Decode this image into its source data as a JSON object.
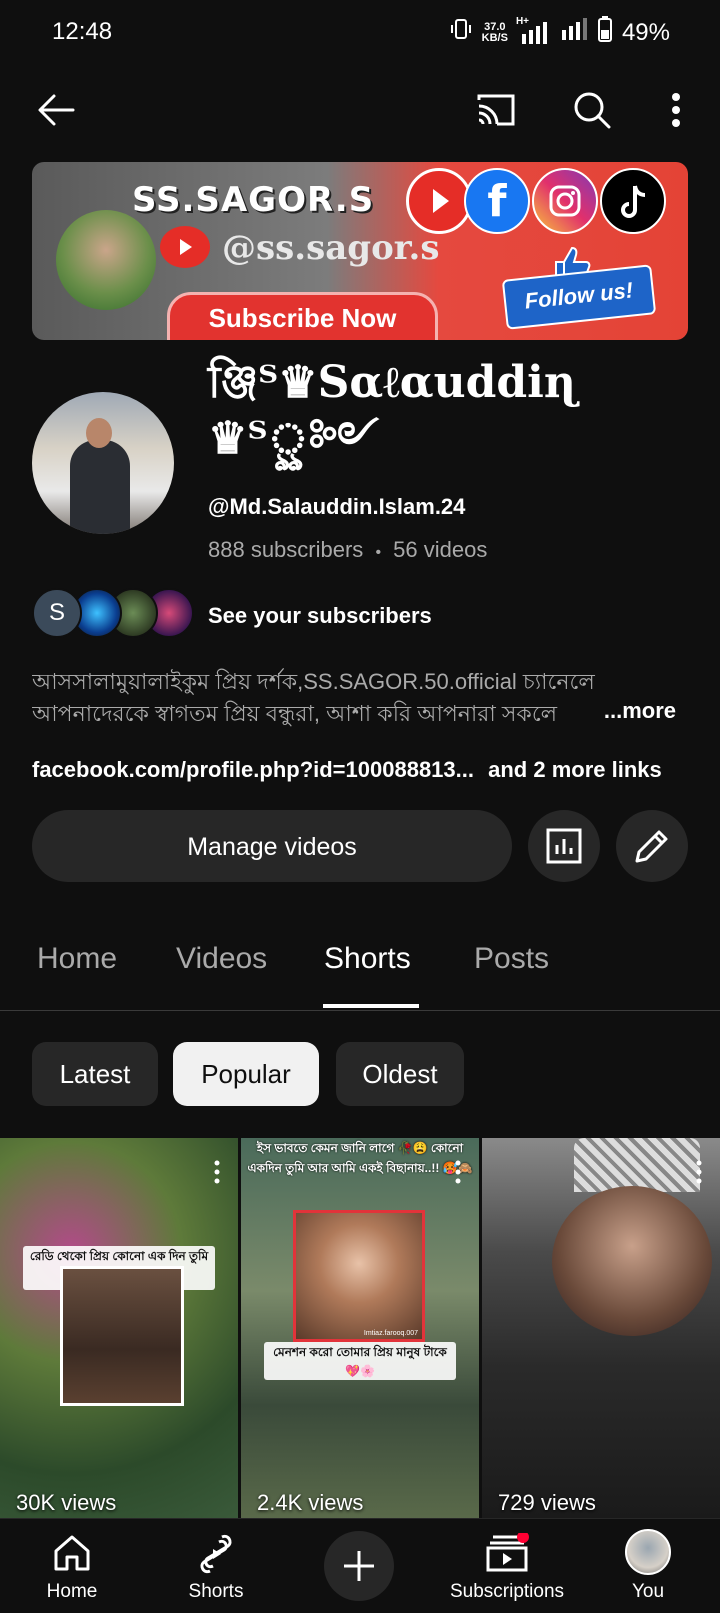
{
  "status_bar": {
    "time": "12:48",
    "net_speed_value": "37.0",
    "net_speed_unit": "KB/S",
    "network_type": "H+",
    "battery": "49%"
  },
  "banner": {
    "title": "SS.SAGOR.S",
    "handle": "@ss.sagor.s",
    "subscribe": "Subscribe Now",
    "follow": "Follow us!"
  },
  "channel": {
    "name": "ঞ্জিᵀ♛Sαℓαuddiɳ ♛ᵀৣ༻",
    "handle": "@Md.Salauddin.Islam.24",
    "subscribers": "888 subscribers",
    "separator": "•",
    "videos": "56 videos",
    "subscriber_initial": "S",
    "see_subscribers": "See your subscribers",
    "description": "আসসালামুয়ালাইকুম প্রিয় দর্শক,SS.SAGOR.50.official  চ্যানেলে আপনাদেরকে স্বাগতম প্রিয় বন্ধুরা, আশা করি আপনারা সকলে",
    "more": "...more",
    "link": "facebook.com/profile.php?id=100088813...",
    "more_links": "and 2 more links"
  },
  "actions": {
    "manage_videos": "Manage videos"
  },
  "tabs": [
    {
      "label": "Home",
      "active": false
    },
    {
      "label": "Videos",
      "active": false
    },
    {
      "label": "Shorts",
      "active": true
    },
    {
      "label": "Posts",
      "active": false
    }
  ],
  "chips": [
    {
      "label": "Latest",
      "selected": false
    },
    {
      "label": "Popular",
      "selected": true
    },
    {
      "label": "Oldest",
      "selected": false
    }
  ],
  "shorts": [
    {
      "views": "30K views",
      "caption": "রেডি থেকো প্রিয় কোনো এক দিন তুমি আর আমি.! 😁🙈"
    },
    {
      "views": "2.4K views",
      "caption_top": "ইস ভাবতে কেমন জানি লাগে 🥀😩 কোনো একদিন তুমি আর আমি একই বিছানায়..!! 🥵🙈",
      "caption_bottom": "মেনশন করো তোমার প্রিয় মানুষ টাকে 💖🌸",
      "watermark": "Imtiaz.farooq.007"
    },
    {
      "views": "729 views"
    }
  ],
  "bottom_nav": {
    "home": "Home",
    "shorts": "Shorts",
    "subscriptions": "Subscriptions",
    "you": "You"
  }
}
